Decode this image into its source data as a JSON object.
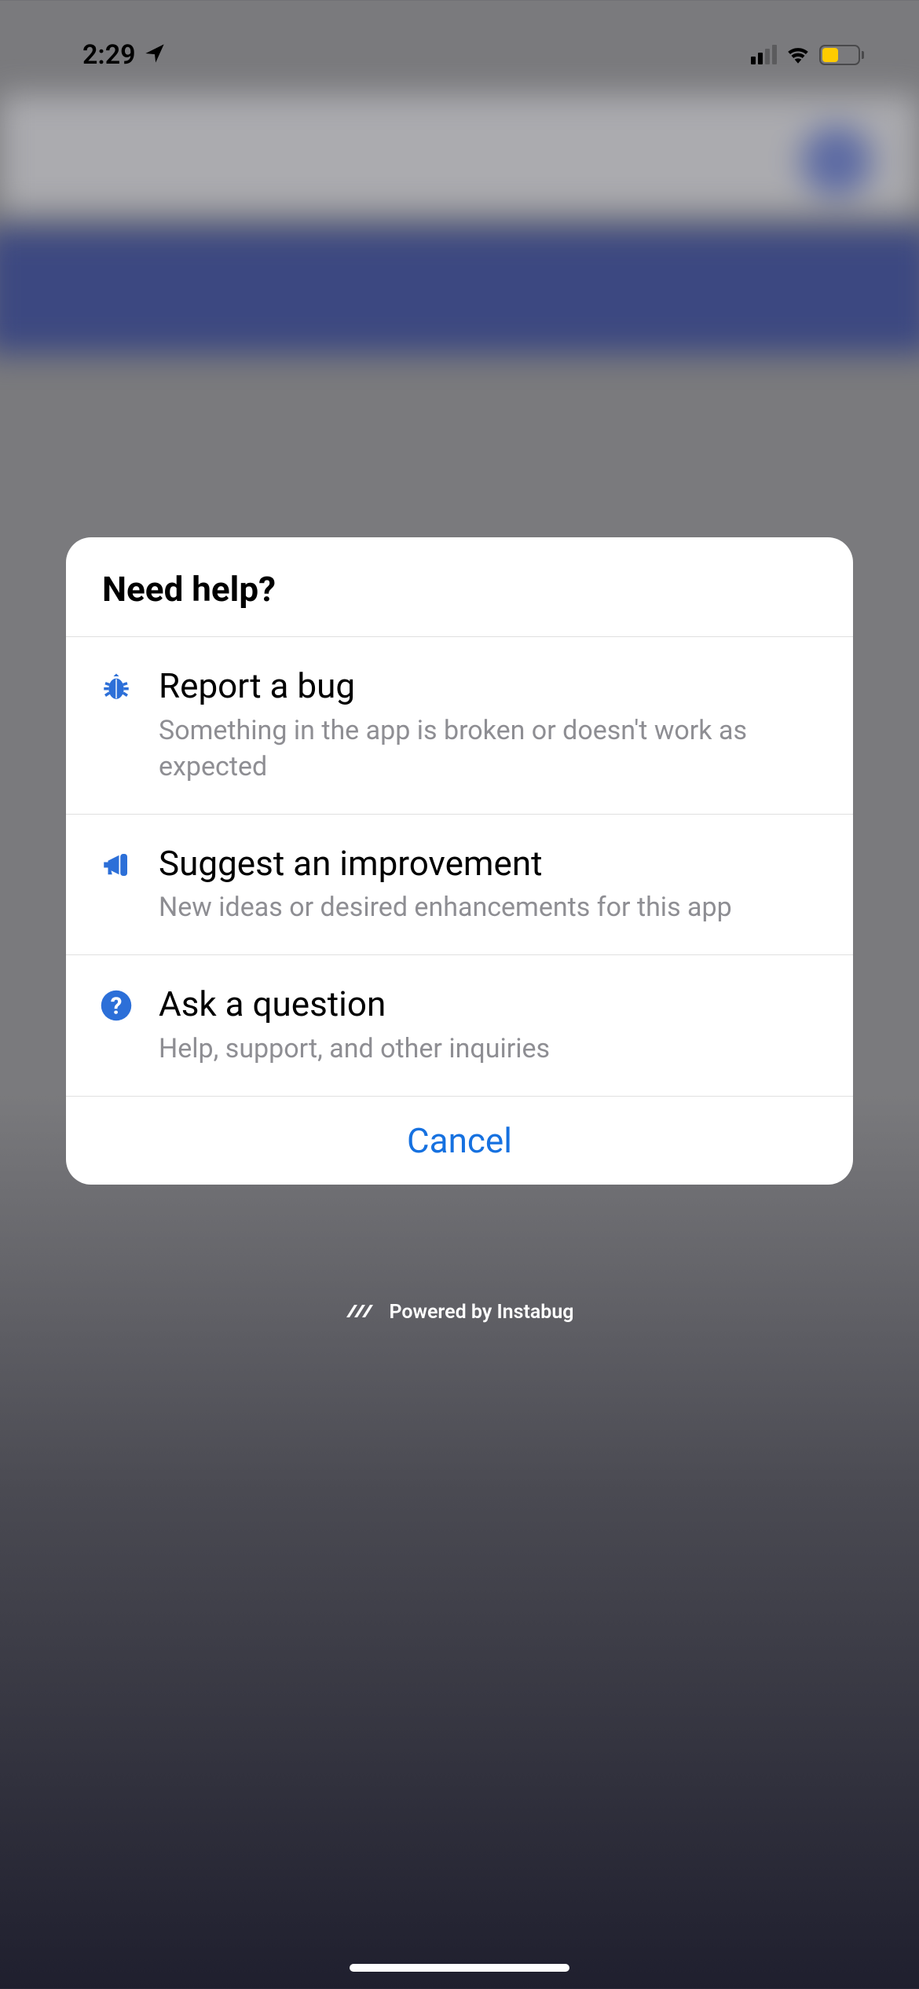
{
  "status": {
    "time": "2:29"
  },
  "modal": {
    "title": "Need help?",
    "options": [
      {
        "title": "Report a bug",
        "subtitle": "Something in the app is broken or doesn't work as expected"
      },
      {
        "title": "Suggest an improvement",
        "subtitle": "New ideas or desired enhancements for this app"
      },
      {
        "title": "Ask a question",
        "subtitle": "Help, support, and other inquiries"
      }
    ],
    "cancel": "Cancel"
  },
  "footer": {
    "powered_by": "Powered by Instabug"
  },
  "colors": {
    "accent_blue": "#1671e0",
    "icon_blue": "#2c6fd8",
    "subtitle_gray": "#8e8e93",
    "battery_yellow": "#ffcc00"
  }
}
